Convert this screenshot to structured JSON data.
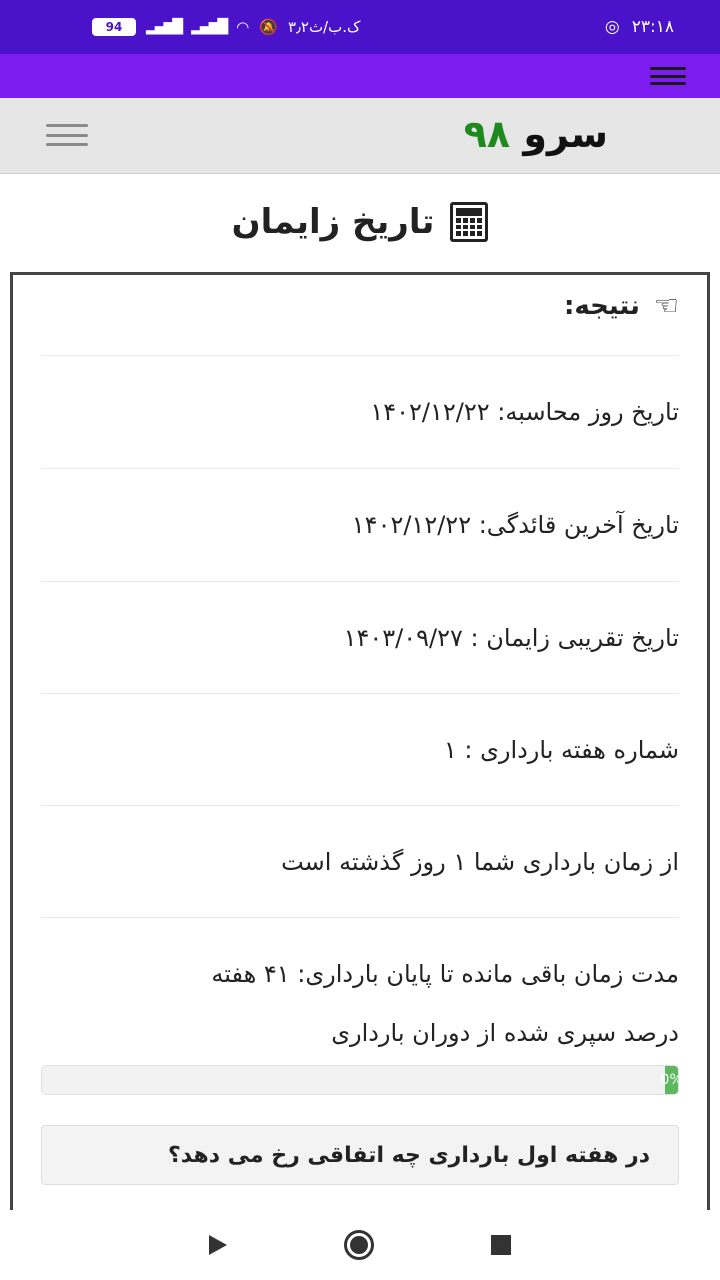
{
  "status_bar": {
    "battery": "94",
    "network": "۳٫۲ک.ب/ث",
    "time": "۲۳:۱۸"
  },
  "site": {
    "logo_word": "سرو",
    "logo_number": "۹۸"
  },
  "page": {
    "title": "تاریخ زایمان"
  },
  "result": {
    "heading": "نتیجه:",
    "rows": [
      "تاریخ روز محاسبه: ۱۴۰۲/۱۲/۲۲",
      "تاریخ آخرین قائدگی: ۱۴۰۲/۱۲/۲۲",
      "تاریخ تقریبی زایمان : ۱۴۰۳/۰۹/۲۷",
      "شماره هفته بارداری : ۱",
      "از زمان بارداری شما ۱ روز گذشته است",
      "مدت زمان باقی مانده تا پایان بارداری: ۴۱ هفته"
    ],
    "percent_label": "درصد سپری شده از دوران بارداری",
    "progress_text": "0%",
    "progress_fraction": 0.02
  },
  "accordion": {
    "label": "در هفته اول بارداری چه اتفاقی رخ می دهد؟"
  },
  "icons": {
    "wifi": "wifi-icon",
    "instagram": "instagram-icon",
    "calculator": "calculator-icon",
    "hand": "hand-pointing-icon"
  }
}
